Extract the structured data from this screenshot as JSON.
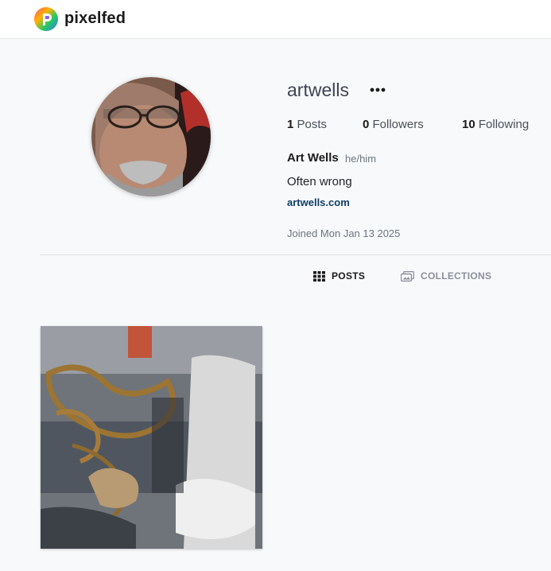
{
  "header": {
    "brand": "pixelfed",
    "logo_icon": "pixelfed-logo-icon"
  },
  "profile": {
    "username": "artwells",
    "more_icon": "ellipsis-icon",
    "stats": {
      "posts_count": "1",
      "posts_label": "Posts",
      "followers_count": "0",
      "followers_label": "Followers",
      "following_count": "10",
      "following_label": "Following"
    },
    "display_name": "Art Wells",
    "pronouns": "he/him",
    "bio": "Often wrong",
    "website": "artwells.com",
    "joined": "Joined Mon Jan 13 2025"
  },
  "tabs": [
    {
      "label": "POSTS",
      "icon": "grid-icon",
      "active": true
    },
    {
      "label": "COLLECTIONS",
      "icon": "images-icon",
      "active": false
    }
  ],
  "posts": [
    {
      "description": "abstract collage photo"
    }
  ],
  "colors": {
    "link": "#0f3d66",
    "background": "#f8f9fb",
    "muted": "#6c757d"
  }
}
